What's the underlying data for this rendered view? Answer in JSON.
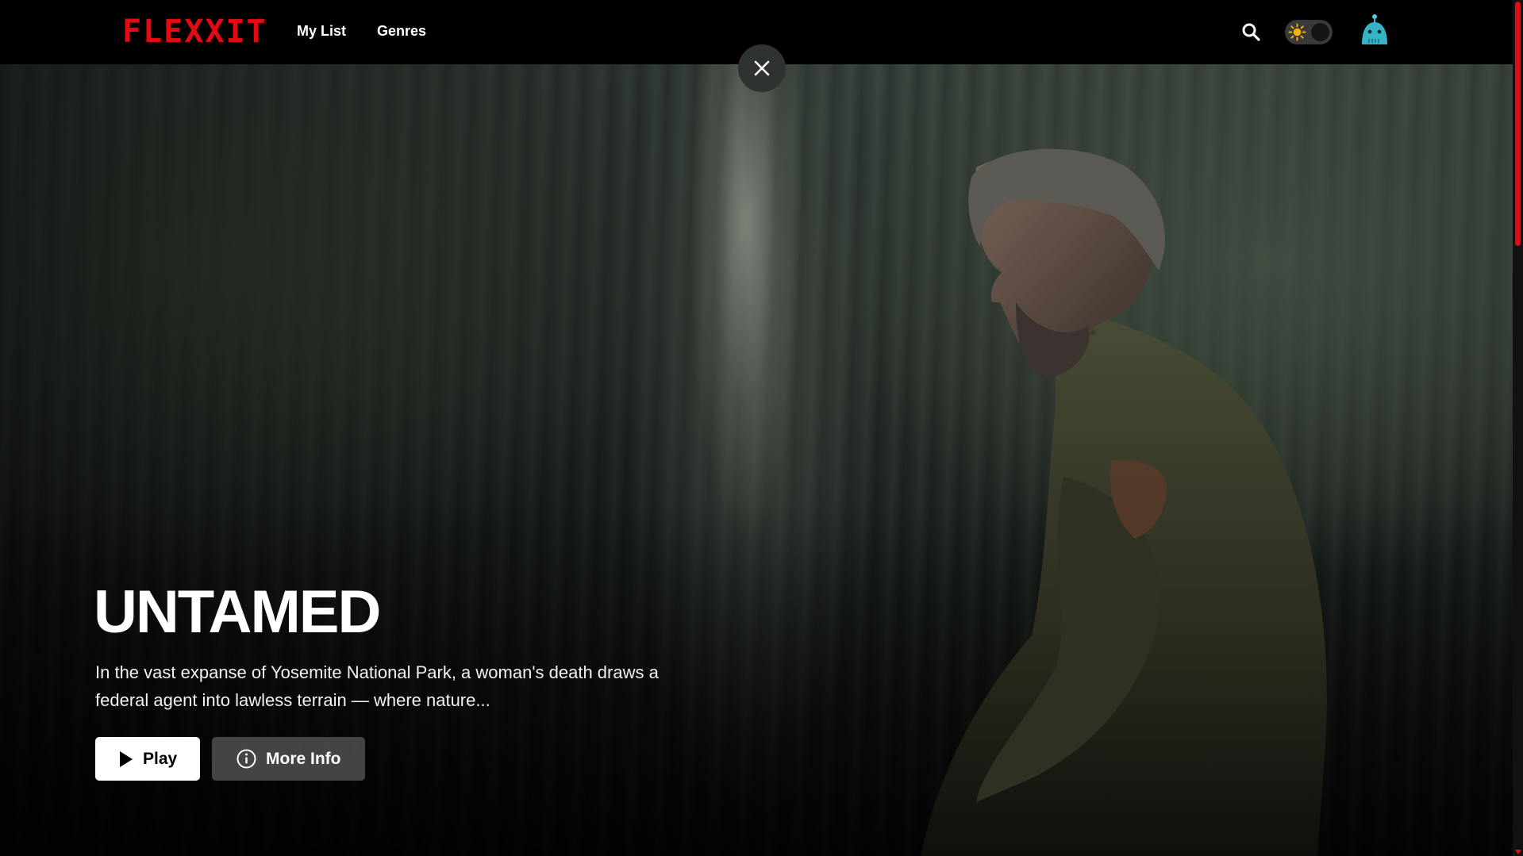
{
  "header": {
    "logo": "FLEXXIT",
    "nav": [
      {
        "label": "My List"
      },
      {
        "label": "Genres"
      }
    ],
    "theme_toggle": {
      "state": "dark"
    }
  },
  "hero": {
    "title": "UNTAMED",
    "description": "In the vast expanse of Yosemite National Park, a woman's death draws a federal agent into lawless terrain — where nature...",
    "play_label": "Play",
    "info_label": "More Info"
  },
  "colors": {
    "brand": "#e50914",
    "header_bg": "#000000",
    "play_bg": "#ffffff",
    "info_bg": "#5a5a5a"
  },
  "icons": {
    "close": "close-icon",
    "search": "search-icon",
    "sun": "sun-icon",
    "avatar": "robot-avatar-icon",
    "play": "play-icon",
    "info": "info-icon"
  }
}
